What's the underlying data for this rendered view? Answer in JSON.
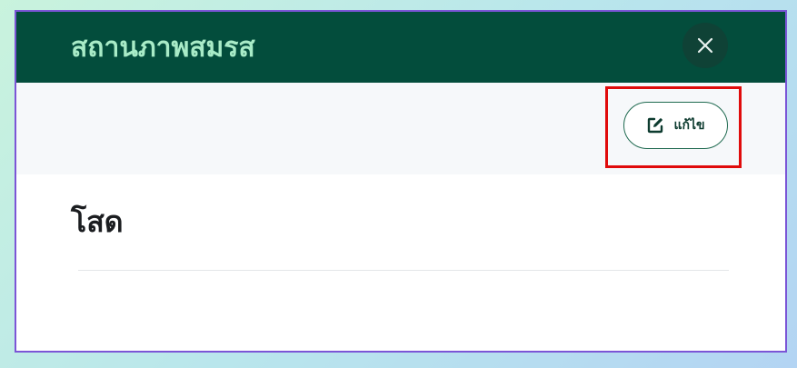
{
  "modal": {
    "title": "สถานภาพสมรส",
    "close_icon": "close-icon",
    "edit_button": {
      "label": "แก้ไข",
      "icon": "edit-icon"
    },
    "value": "โสด"
  },
  "colors": {
    "header_bg": "#034d3c",
    "title_text": "#a8ebc7",
    "close_button_bg": "#0f4236",
    "toolbar_bg": "#f6f8fa",
    "edit_button_border": "#1f6a50",
    "highlight_border": "#e00b0b",
    "modal_border": "#7b55d6"
  }
}
